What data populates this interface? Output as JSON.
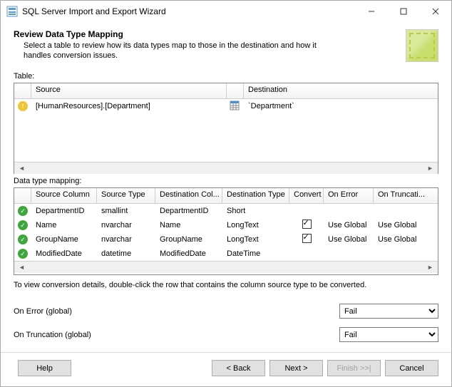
{
  "window": {
    "title": "SQL Server Import and Export Wizard"
  },
  "header": {
    "title": "Review Data Type Mapping",
    "desc": "Select a table to review how its data types map to those in the destination and how it handles conversion issues."
  },
  "table_section": {
    "label": "Table:",
    "columns": {
      "source": "Source",
      "destination": "Destination"
    },
    "rows": [
      {
        "source": "[HumanResources].[Department]",
        "destination": "`Department`"
      }
    ]
  },
  "mapping_section": {
    "label": "Data type mapping:",
    "columns": {
      "source_column": "Source Column",
      "source_type": "Source Type",
      "dest_column": "Destination Col...",
      "dest_type": "Destination Type",
      "convert": "Convert",
      "on_error": "On Error",
      "on_truncation": "On Truncati..."
    },
    "rows": [
      {
        "status": "ok",
        "source_column": "DepartmentID",
        "source_type": "smallint",
        "dest_column": "DepartmentID",
        "dest_type": "Short",
        "convert": false,
        "on_error": "",
        "on_truncation": ""
      },
      {
        "status": "ok",
        "source_column": "Name",
        "source_type": "nvarchar",
        "dest_column": "Name",
        "dest_type": "LongText",
        "convert": true,
        "on_error": "Use Global",
        "on_truncation": "Use Global"
      },
      {
        "status": "ok",
        "source_column": "GroupName",
        "source_type": "nvarchar",
        "dest_column": "GroupName",
        "dest_type": "LongText",
        "convert": true,
        "on_error": "Use Global",
        "on_truncation": "Use Global"
      },
      {
        "status": "ok",
        "source_column": "ModifiedDate",
        "source_type": "datetime",
        "dest_column": "ModifiedDate",
        "dest_type": "DateTime",
        "convert": false,
        "on_error": "",
        "on_truncation": ""
      }
    ]
  },
  "hint": "To view conversion details, double-click the row that contains the column source type to be converted.",
  "globals": {
    "on_error_label": "On Error (global)",
    "on_error_value": "Fail",
    "on_truncation_label": "On Truncation (global)",
    "on_truncation_value": "Fail"
  },
  "footer": {
    "help": "Help",
    "back": "< Back",
    "next": "Next >",
    "finish": "Finish >>|",
    "cancel": "Cancel"
  }
}
